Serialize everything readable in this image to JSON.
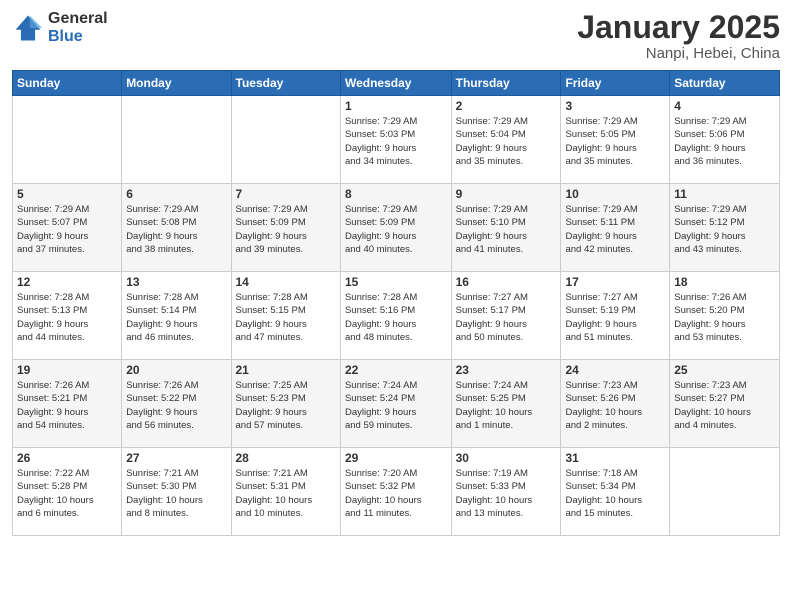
{
  "logo": {
    "general": "General",
    "blue": "Blue"
  },
  "header": {
    "month": "January 2025",
    "location": "Nanpi, Hebei, China"
  },
  "weekdays": [
    "Sunday",
    "Monday",
    "Tuesday",
    "Wednesday",
    "Thursday",
    "Friday",
    "Saturday"
  ],
  "weeks": [
    [
      {
        "day": "",
        "info": ""
      },
      {
        "day": "",
        "info": ""
      },
      {
        "day": "",
        "info": ""
      },
      {
        "day": "1",
        "info": "Sunrise: 7:29 AM\nSunset: 5:03 PM\nDaylight: 9 hours\nand 34 minutes."
      },
      {
        "day": "2",
        "info": "Sunrise: 7:29 AM\nSunset: 5:04 PM\nDaylight: 9 hours\nand 35 minutes."
      },
      {
        "day": "3",
        "info": "Sunrise: 7:29 AM\nSunset: 5:05 PM\nDaylight: 9 hours\nand 35 minutes."
      },
      {
        "day": "4",
        "info": "Sunrise: 7:29 AM\nSunset: 5:06 PM\nDaylight: 9 hours\nand 36 minutes."
      }
    ],
    [
      {
        "day": "5",
        "info": "Sunrise: 7:29 AM\nSunset: 5:07 PM\nDaylight: 9 hours\nand 37 minutes."
      },
      {
        "day": "6",
        "info": "Sunrise: 7:29 AM\nSunset: 5:08 PM\nDaylight: 9 hours\nand 38 minutes."
      },
      {
        "day": "7",
        "info": "Sunrise: 7:29 AM\nSunset: 5:09 PM\nDaylight: 9 hours\nand 39 minutes."
      },
      {
        "day": "8",
        "info": "Sunrise: 7:29 AM\nSunset: 5:09 PM\nDaylight: 9 hours\nand 40 minutes."
      },
      {
        "day": "9",
        "info": "Sunrise: 7:29 AM\nSunset: 5:10 PM\nDaylight: 9 hours\nand 41 minutes."
      },
      {
        "day": "10",
        "info": "Sunrise: 7:29 AM\nSunset: 5:11 PM\nDaylight: 9 hours\nand 42 minutes."
      },
      {
        "day": "11",
        "info": "Sunrise: 7:29 AM\nSunset: 5:12 PM\nDaylight: 9 hours\nand 43 minutes."
      }
    ],
    [
      {
        "day": "12",
        "info": "Sunrise: 7:28 AM\nSunset: 5:13 PM\nDaylight: 9 hours\nand 44 minutes."
      },
      {
        "day": "13",
        "info": "Sunrise: 7:28 AM\nSunset: 5:14 PM\nDaylight: 9 hours\nand 46 minutes."
      },
      {
        "day": "14",
        "info": "Sunrise: 7:28 AM\nSunset: 5:15 PM\nDaylight: 9 hours\nand 47 minutes."
      },
      {
        "day": "15",
        "info": "Sunrise: 7:28 AM\nSunset: 5:16 PM\nDaylight: 9 hours\nand 48 minutes."
      },
      {
        "day": "16",
        "info": "Sunrise: 7:27 AM\nSunset: 5:17 PM\nDaylight: 9 hours\nand 50 minutes."
      },
      {
        "day": "17",
        "info": "Sunrise: 7:27 AM\nSunset: 5:19 PM\nDaylight: 9 hours\nand 51 minutes."
      },
      {
        "day": "18",
        "info": "Sunrise: 7:26 AM\nSunset: 5:20 PM\nDaylight: 9 hours\nand 53 minutes."
      }
    ],
    [
      {
        "day": "19",
        "info": "Sunrise: 7:26 AM\nSunset: 5:21 PM\nDaylight: 9 hours\nand 54 minutes."
      },
      {
        "day": "20",
        "info": "Sunrise: 7:26 AM\nSunset: 5:22 PM\nDaylight: 9 hours\nand 56 minutes."
      },
      {
        "day": "21",
        "info": "Sunrise: 7:25 AM\nSunset: 5:23 PM\nDaylight: 9 hours\nand 57 minutes."
      },
      {
        "day": "22",
        "info": "Sunrise: 7:24 AM\nSunset: 5:24 PM\nDaylight: 9 hours\nand 59 minutes."
      },
      {
        "day": "23",
        "info": "Sunrise: 7:24 AM\nSunset: 5:25 PM\nDaylight: 10 hours\nand 1 minute."
      },
      {
        "day": "24",
        "info": "Sunrise: 7:23 AM\nSunset: 5:26 PM\nDaylight: 10 hours\nand 2 minutes."
      },
      {
        "day": "25",
        "info": "Sunrise: 7:23 AM\nSunset: 5:27 PM\nDaylight: 10 hours\nand 4 minutes."
      }
    ],
    [
      {
        "day": "26",
        "info": "Sunrise: 7:22 AM\nSunset: 5:28 PM\nDaylight: 10 hours\nand 6 minutes."
      },
      {
        "day": "27",
        "info": "Sunrise: 7:21 AM\nSunset: 5:30 PM\nDaylight: 10 hours\nand 8 minutes."
      },
      {
        "day": "28",
        "info": "Sunrise: 7:21 AM\nSunset: 5:31 PM\nDaylight: 10 hours\nand 10 minutes."
      },
      {
        "day": "29",
        "info": "Sunrise: 7:20 AM\nSunset: 5:32 PM\nDaylight: 10 hours\nand 11 minutes."
      },
      {
        "day": "30",
        "info": "Sunrise: 7:19 AM\nSunset: 5:33 PM\nDaylight: 10 hours\nand 13 minutes."
      },
      {
        "day": "31",
        "info": "Sunrise: 7:18 AM\nSunset: 5:34 PM\nDaylight: 10 hours\nand 15 minutes."
      },
      {
        "day": "",
        "info": ""
      }
    ]
  ]
}
